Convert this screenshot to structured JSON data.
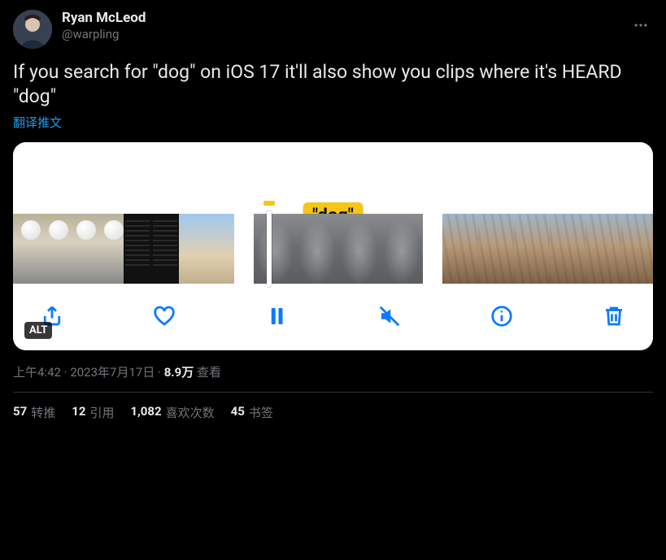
{
  "author": {
    "display_name": "Ryan McLeod",
    "handle": "@warpling"
  },
  "tweet_text": "If you search for \"dog\" on iOS 17 it'll also show you clips where it's HEARD \"dog\"",
  "translate_label": "翻译推文",
  "media": {
    "caption_bubble": "\"dog\"",
    "alt_badge": "ALT"
  },
  "meta": {
    "time": "上午4:42",
    "date": "2023年7月17日",
    "views_count": "8.9万",
    "views_label": "查看",
    "separator": " · "
  },
  "stats": {
    "retweets": {
      "count": "57",
      "label": "转推"
    },
    "quotes": {
      "count": "12",
      "label": "引用"
    },
    "likes": {
      "count": "1,082",
      "label": "喜欢次数"
    },
    "bookmarks": {
      "count": "45",
      "label": "书签"
    }
  }
}
